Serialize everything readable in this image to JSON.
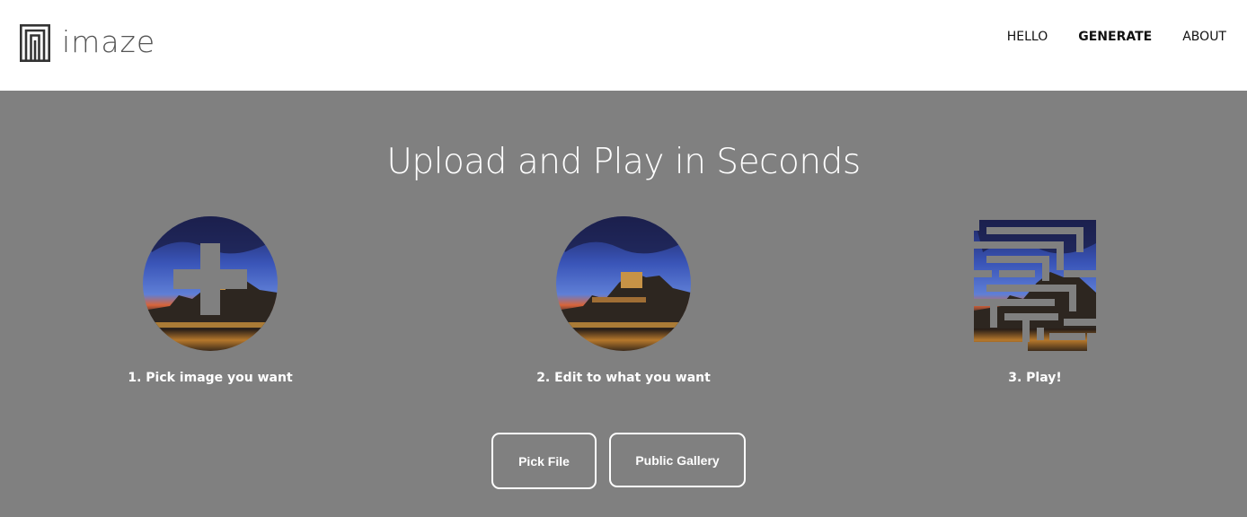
{
  "brand": {
    "name": "imaze"
  },
  "nav": {
    "items": [
      {
        "label": "HELLO",
        "active": false
      },
      {
        "label": "GENERATE",
        "active": true
      },
      {
        "label": "ABOUT",
        "active": false
      }
    ]
  },
  "main": {
    "headline": "Upload and Play in Seconds",
    "steps": [
      {
        "label": "1. Pick image you want",
        "icon": "plus-icon"
      },
      {
        "label": "2. Edit to what you want",
        "icon": "image-circle"
      },
      {
        "label": "3. Play!",
        "icon": "maze-icon"
      }
    ],
    "buttons": {
      "pick_file": "Pick File",
      "public_gallery": "Public Gallery"
    }
  },
  "colors": {
    "background": "#808080",
    "header": "#ffffff",
    "text_light": "#ffffff",
    "sky": "#2b3f8f",
    "sunset": "#e0622a"
  }
}
